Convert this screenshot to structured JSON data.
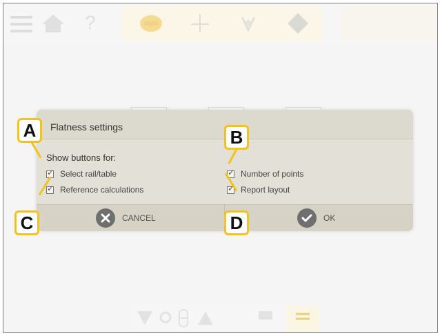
{
  "toolbar": {
    "icons": [
      "menu-icon",
      "home-icon",
      "help-icon",
      "flatness-icon",
      "crosshair-icon",
      "valve-icon",
      "diamond-icon"
    ],
    "help_glyph": "?"
  },
  "dialog": {
    "title": "Flatness settings",
    "section_label": "Show buttons for:",
    "options": [
      {
        "label": "Select rail/table",
        "checked": true
      },
      {
        "label": "Reference calculations",
        "checked": true
      },
      {
        "label": "Number of points",
        "checked": true
      },
      {
        "label": "Report layout",
        "checked": true
      }
    ],
    "cancel_label": "CANCEL",
    "ok_label": "OK"
  },
  "callouts": {
    "a": "A",
    "b": "B",
    "c": "C",
    "d": "D"
  },
  "colors": {
    "callout_border": "#f2c318",
    "dialog_bg": "#e3e0d7",
    "button_circle": "#6f6f6f"
  }
}
